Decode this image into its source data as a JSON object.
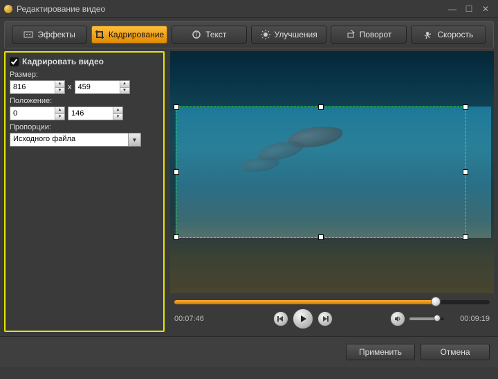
{
  "window": {
    "title": "Редактирование видео"
  },
  "tabs": {
    "effects": "Эффекты",
    "crop": "Кадрирование",
    "text": "Текст",
    "enhance": "Улучшения",
    "rotate": "Поворот",
    "speed": "Скорость"
  },
  "panel": {
    "crop_checkbox": "Кадрировать видео",
    "size_label": "Размер:",
    "size_w": "816",
    "size_h": "459",
    "size_sep": "x",
    "pos_label": "Положение:",
    "pos_x": "0",
    "pos_y": "146",
    "ratio_label": "Пропорции:",
    "ratio_value": "Исходного файла"
  },
  "timeline": {
    "current": "00:07:46",
    "total": "00:09:19"
  },
  "footer": {
    "apply": "Применить",
    "cancel": "Отмена"
  }
}
